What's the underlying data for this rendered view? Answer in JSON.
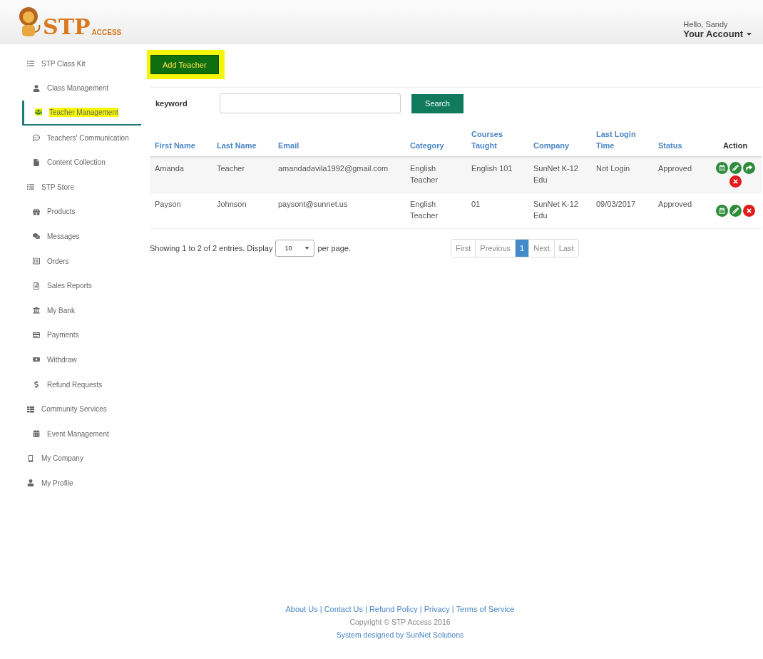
{
  "header": {
    "logo": {
      "main": "STP",
      "sub": "ACCESS"
    },
    "greeting": "Hello, Sandy",
    "account": "Your Account"
  },
  "sidebar": {
    "items": [
      {
        "label": "STP Class Kit",
        "selected": false,
        "children": [
          {
            "label": "Class Management",
            "selected": false
          },
          {
            "label": "Teacher Management",
            "selected": true
          },
          {
            "label": "Teachers' Communication",
            "selected": false
          },
          {
            "label": "Content Collection",
            "selected": false
          }
        ]
      },
      {
        "label": "STP Store",
        "selected": false,
        "children": [
          {
            "label": "Products",
            "selected": false
          },
          {
            "label": "Messages",
            "selected": false
          },
          {
            "label": "Orders",
            "selected": false
          },
          {
            "label": "Sales Reports",
            "selected": false
          },
          {
            "label": "My Bank",
            "selected": false
          },
          {
            "label": "Payments",
            "selected": false
          },
          {
            "label": "Withdraw",
            "selected": false
          },
          {
            "label": "Refund Requests",
            "selected": false
          }
        ]
      },
      {
        "label": "Community Services",
        "selected": false,
        "children": [
          {
            "label": "Event Management",
            "selected": false
          }
        ]
      },
      {
        "label": "My Company",
        "selected": false
      },
      {
        "label": "My Profile",
        "selected": false
      }
    ]
  },
  "add_button": {
    "label": "Add Teacher",
    "highlighted": true
  },
  "search": {
    "label": "keyword",
    "button": "Search"
  },
  "table": {
    "columns": [
      "First Name",
      "Last Name",
      "Email",
      "Category",
      "Courses Taught",
      "Company",
      "Last Login Time",
      "Status",
      "Action"
    ],
    "rows": [
      {
        "cells": [
          "Amanda",
          "Teacher",
          "amandadavila1992@gmail.com",
          "English Teacher",
          "English 101",
          "SunNet K-12 Edu",
          "Not Login",
          "Approved"
        ],
        "actions": [
          {
            "kind": "calendar"
          },
          {
            "kind": "edit"
          },
          {
            "kind": "share"
          },
          {
            "kind": "delete"
          }
        ]
      },
      {
        "cells": [
          "Payson",
          "Johnson",
          "paysont@sunnet.us",
          "English Teacher",
          "01",
          "SunNet K-12 Edu",
          "09/03/2017",
          "Approved"
        ],
        "actions": [
          {
            "kind": "calendar"
          },
          {
            "kind": "edit"
          },
          {
            "kind": "delete"
          }
        ]
      }
    ]
  },
  "footer_info": {
    "showing": "Showing 1 to 2 of 2 entries. Display",
    "page_size": "10",
    "per_page": "per page."
  },
  "pagination": [
    {
      "label": "First",
      "selected": false
    },
    {
      "label": "Previous",
      "selected": false
    },
    {
      "label": "1",
      "selected": true
    },
    {
      "label": "Next",
      "selected": false
    },
    {
      "label": "Last",
      "selected": false
    }
  ],
  "footer": {
    "links": [
      "About Us",
      "Contact Us",
      "Refund Policy",
      "Privacy",
      "Terms of Service"
    ],
    "separator": "|",
    "copyright": "Copyright © STP Access 2016",
    "credit": "System designed by SunNet Solutions"
  }
}
